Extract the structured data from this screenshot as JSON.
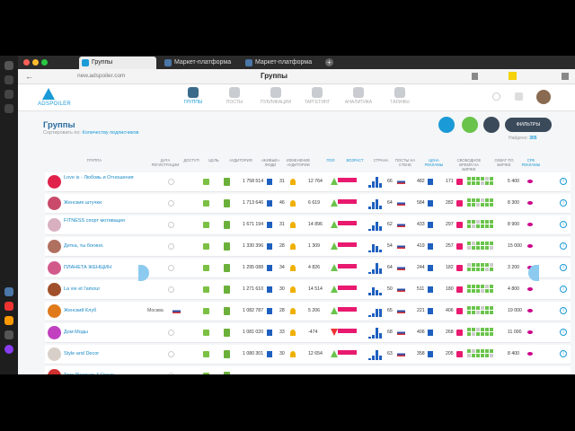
{
  "browser": {
    "tabs": [
      {
        "label": "Группы",
        "active": true
      },
      {
        "label": "Маркет-платформа",
        "active": false
      },
      {
        "label": "Маркет-платформа",
        "active": false
      }
    ],
    "url": "new.adspoiler.com",
    "page_title": "Группы"
  },
  "nav": {
    "logo": "ADSPOILER",
    "items": [
      "ГРУППЫ",
      "ПОСТЫ",
      "ПУБЛИКАЦИИ",
      "ТАРГЕТИНГ",
      "АНАЛИТИКА",
      "ТАРИФЫ"
    ]
  },
  "header": {
    "title": "Группы",
    "sort_label": "Сортировать по:",
    "sort_value": "Количеству подписчиков",
    "filters_button": "ФИЛЬТРЫ",
    "found_label": "Найдено:",
    "found_count": "305"
  },
  "columns": [
    "ГРУППА",
    "ДАТА РЕГИСТРАЦИИ",
    "ДОСТУП",
    "ЦЕЛЬ",
    "АУДИТОРИЯ",
    "«ЖИВЫЕ» ЛЮДИ",
    "ИЗМЕНЕНИЕ АУДИТОРИИ",
    "ПОЛ",
    "ВОЗРАСТ",
    "СТРАНА",
    "ПОСТЫ НА СТЕНЕ",
    "ЦЕНА РЕКЛАМЫ",
    "СВОБОДНОЕ ВРЕМЯ НА БИРЖЕ",
    "ОХВАТ ПО БИРЖЕ",
    "СРЕ РЕКЛАМЫ"
  ],
  "rows": [
    {
      "name": "Love is - Любовь и Отношения",
      "reg": "",
      "audience": "1 758 514",
      "live": "31",
      "change": "12 764",
      "country": "66",
      "posts": "482",
      "price": "171",
      "reach": "5 400",
      "color": "#e0224b"
    },
    {
      "name": "Женские штучки",
      "reg": "",
      "audience": "1 713 646",
      "live": "46",
      "change": "6 619",
      "country": "64",
      "posts": "584",
      "price": "282",
      "reach": "8 300",
      "color": "#c94a6a"
    },
    {
      "name": "FITNESS спорт мотивация",
      "reg": "",
      "audience": "1 671 194",
      "live": "31",
      "change": "14 896",
      "country": "62",
      "posts": "433",
      "price": "297",
      "reach": "8 900",
      "color": "#d9b0c0"
    },
    {
      "name": "Детка, ты богиня.",
      "reg": "",
      "audience": "1 330 396",
      "live": "28",
      "change": "1 309",
      "country": "54",
      "posts": "419",
      "price": "257",
      "reach": "15 000",
      "color": "#b07060"
    },
    {
      "name": "ПЛАНЕТА ЖЕНЩИН",
      "reg": "",
      "audience": "1 295 088",
      "live": "34",
      "change": "4 826",
      "country": "64",
      "posts": "244",
      "price": "182",
      "reach": "3 200",
      "color": "#d25a8a"
    },
    {
      "name": "La vie et l'amour",
      "reg": "",
      "audience": "1 271 610",
      "live": "30",
      "change": "14 514",
      "country": "50",
      "posts": "511",
      "price": "180",
      "reach": "4 800",
      "color": "#a0502a"
    },
    {
      "name": "Женский Клуб",
      "reg": "Москва",
      "audience": "1 082 787",
      "live": "28",
      "change": "5 206",
      "country": "65",
      "posts": "221",
      "price": "406",
      "reach": "19 000",
      "color": "#e07a1a"
    },
    {
      "name": "Дом Моды",
      "reg": "",
      "audience": "1 081 020",
      "live": "33",
      "change": "-474",
      "country": "68",
      "posts": "406",
      "price": "268",
      "reach": "11 000",
      "color": "#c040c0"
    },
    {
      "name": "Style and Decor",
      "reg": "",
      "audience": "1 080 301",
      "live": "30",
      "change": "12 654",
      "country": "63",
      "posts": "358",
      "price": "205",
      "reach": "8 400",
      "color": "#d8d0c8"
    },
    {
      "name": "True Pleasure & Грани",
      "reg": "",
      "audience": "",
      "live": "",
      "change": "",
      "country": "",
      "posts": "",
      "price": "",
      "reach": "",
      "color": "#d03030"
    }
  ],
  "colors": {
    "accent": "#1a9ad6",
    "green": "#6ac44b",
    "pink": "#e8196f",
    "blue": "#1e5fbf"
  }
}
